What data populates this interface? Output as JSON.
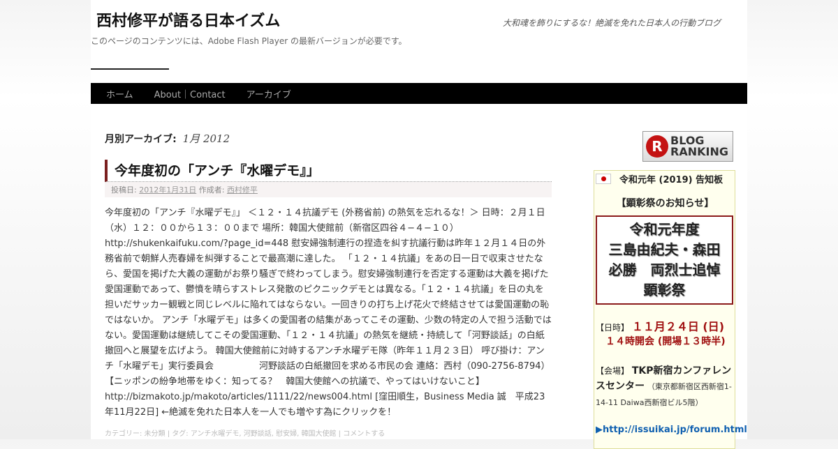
{
  "header": {
    "site_title": "西村修平が語る日本イズム",
    "site_description": "大和魂を飾りにするな！絶滅を免れた日本人の行動ブログ",
    "flash_note": "このページのコンテンツには、Adobe Flash Player の最新バージョンが必要です。"
  },
  "nav": {
    "items": [
      {
        "label": "ホーム"
      },
      {
        "label": "About｜Contact"
      },
      {
        "label": "アーカイブ"
      }
    ]
  },
  "archive": {
    "label": "月別アーカイブ:",
    "month": "1月 2012"
  },
  "post": {
    "title": "今年度初の「アンチ『水曜デモ』」",
    "meta_posted": "投稿日:",
    "meta_date": "2012年1月31日",
    "meta_author_label": "作成者:",
    "meta_author": "西村修平",
    "body": "今年度初の「アンチ『水曜デモ』」 ＜１２・１４抗議デモ (外務省前) の熱気を忘れるな！＞ 日時：２月１日（水）１２：００から１３：００まで 場所：韓国大使館前（新宿区四谷４−４−１０） http://shukenkaifuku.com/?page_id=448 慰安婦強制連行の捏造を糾す抗議行動は昨年１２月１４日の外務省前で朝鮮人売春婦を糾弾することで最高潮に達した。 「１２・１４抗議」をあの日一日で収束させたなら、愛国を掲げた大義の運動がお祭り騒ぎで終わってしまう。慰安婦強制連行を否定する運動は大義を掲げた愛国運動であって、鬱憤を晴らすストレス発散のピクニックデモとは異なる。「１２・１４抗議」を日の丸を担いだサッカー観戦と同じレベルに陥れてはならない。一回きりの打ち上げ花火で終結させては愛国運動の恥ではないか。 アンチ「水曜デモ」は多くの愛国者の結集があってこその運動、少数の特定の人で担う活動ではない。愛国運動は継続してこその愛国運動、「１２・１４抗議」の熱気を継続・持続して「河野談話」の白紙撤回へと展望を広げよう。 韓国大使館前に対峙するアンチ水曜デモ隊（昨年１１月２３日） 呼び掛け：アンチ「水曜デモ」実行委員会　　　　　河野談話の白紙撤回を求める市民の会 連絡：西村（090-2756-8794）【ニッポンの紛争地帯をゆく：知ってる？　韓国大使館への抗議で、やってはいけないこと】 http://bizmakoto.jp/makoto/articles/1111/22/news004.html [窪田順生，Business Media 誠　平成23年11月22日] ←絶滅を免れた日本人を一人でも増やす為にクリックを！",
    "categories": "カテゴリー: 未分類 | タグ: アンチ水曜デモ, 河野談話, 慰安婦, 韓国大使館 | コメントする"
  },
  "sidebar": {
    "badge_letter": "R",
    "badge_text1": "BLOG",
    "badge_text2": "RANKING",
    "notice_head": "令和元年 (2019) 告知板",
    "notice_sub": "【顕彰祭のお知らせ】",
    "box_lines": [
      "令和元年度",
      "三島由紀夫・森田",
      "必勝　両烈士追悼",
      "顕彰祭"
    ],
    "date_label": "【日時】",
    "date_value": "１１月２４日 (日)",
    "time_value": "１４時開会 (開場１３時半)",
    "venue_label": "【会場】",
    "venue_name": "TKP新宿カンファレンスセンター",
    "venue_addr": "（東京都新宿区西新宿1-14-11 Daiwa西新宿ビル5階）",
    "link": "http://issuikai.jp/forum.html"
  }
}
